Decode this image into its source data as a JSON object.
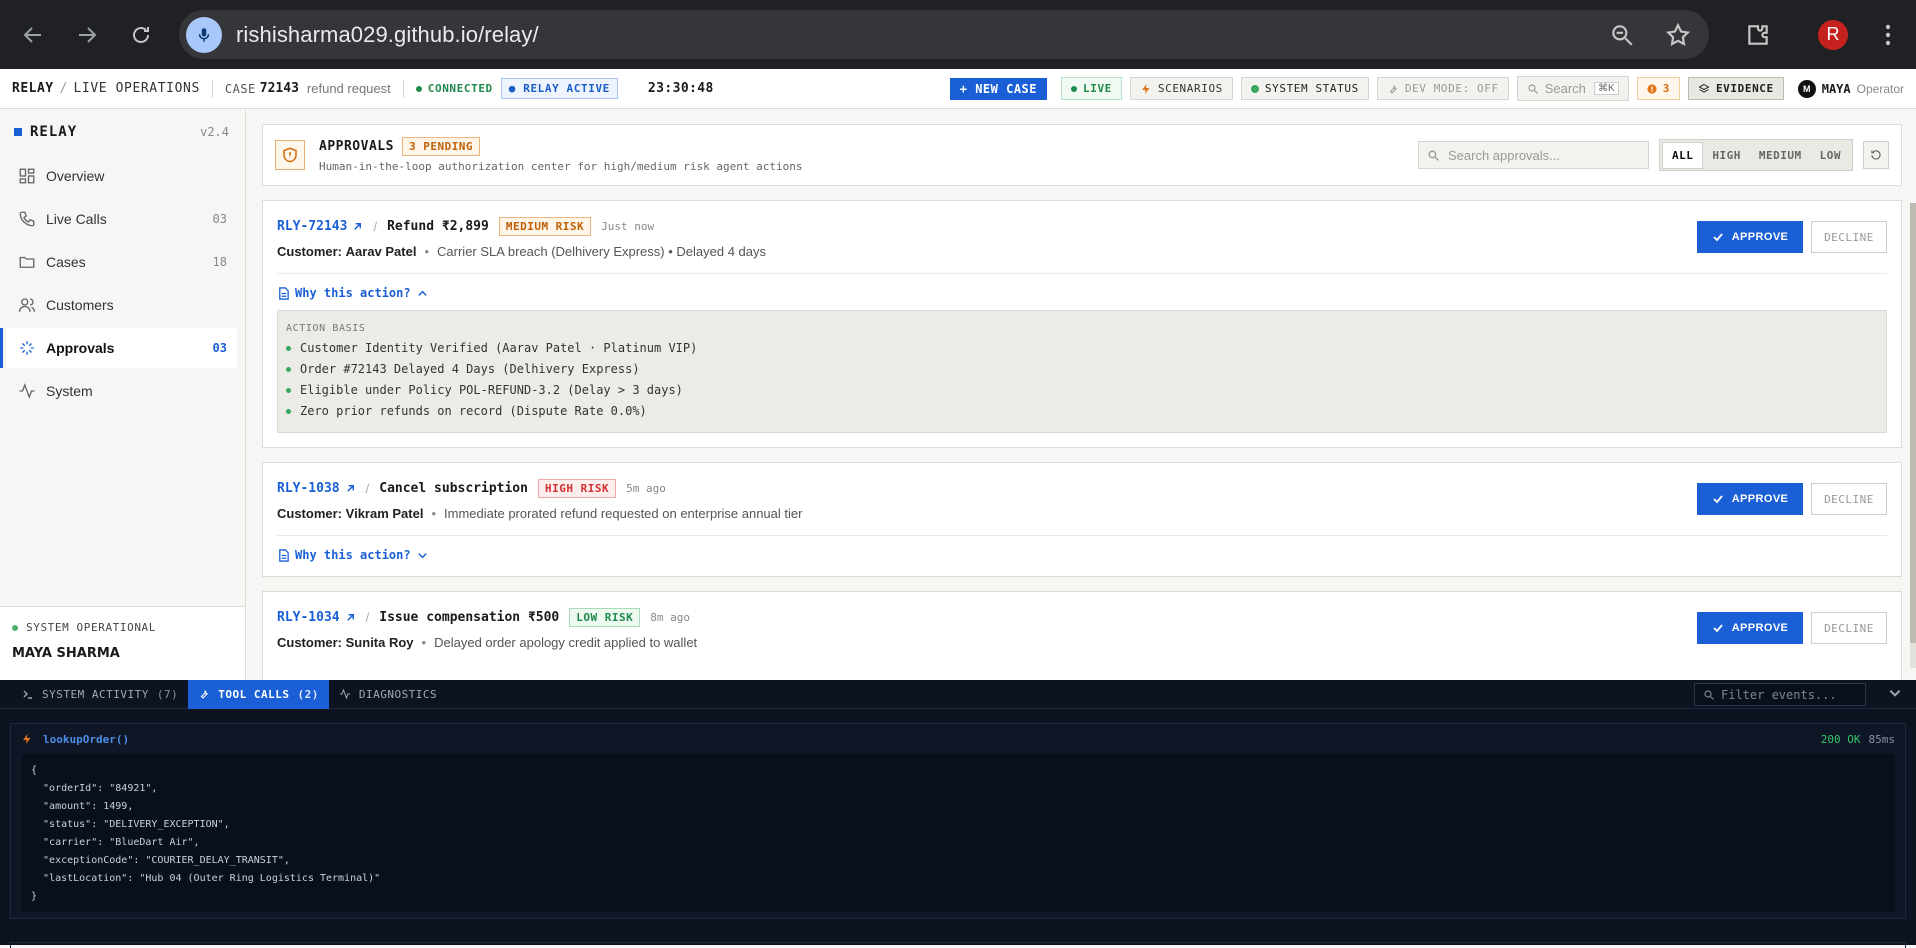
{
  "browser": {
    "url": "rishisharma029.github.io/relay/",
    "avatar_letter": "R"
  },
  "topbar": {
    "brand": "RELAY",
    "sep": "/",
    "section": "LIVE OPERATIONS",
    "case_label": "CASE",
    "case_number": "72143",
    "case_desc": "refund request",
    "connected": "CONNECTED",
    "relay_active": "● RELAY ACTIVE",
    "clock": "23:30:48",
    "new_case": "+ NEW CASE",
    "live": "LIVE",
    "scenarios": "SCENARIOS",
    "system_status": "SYSTEM STATUS",
    "dev_mode": "DEV MODE: OFF",
    "search_placeholder": "Search",
    "search_kbd": "⌘K",
    "alerts": "3",
    "evidence": "EVIDENCE",
    "operator_initial": "M",
    "operator_name": "MAYA",
    "operator_role": "Operator"
  },
  "sidebar": {
    "title": "RELAY",
    "version": "v2.4",
    "items": [
      {
        "label": "Overview",
        "count": ""
      },
      {
        "label": "Live Calls",
        "count": "03"
      },
      {
        "label": "Cases",
        "count": "18"
      },
      {
        "label": "Customers",
        "count": ""
      },
      {
        "label": "Approvals",
        "count": "03"
      },
      {
        "label": "System",
        "count": ""
      }
    ],
    "status": "SYSTEM OPERATIONAL",
    "user": "MAYA SHARMA"
  },
  "approvals": {
    "title": "APPROVALS",
    "pending": "3 PENDING",
    "subtitle": "Human-in-the-loop authorization center for high/medium risk agent actions",
    "search_placeholder": "Search approvals...",
    "filters": [
      "ALL",
      "HIGH",
      "MEDIUM",
      "LOW"
    ],
    "approve_label": "APPROVE",
    "decline_label": "DECLINE",
    "why_label": "Why this action?",
    "customer_prefix": "Customer:",
    "cards": [
      {
        "id": "RLY-72143",
        "action": "Refund ₹2,899",
        "risk": "MEDIUM RISK",
        "time": "Just now",
        "customer": "Aarav Patel",
        "detail": "Carrier SLA breach (Delhivery Express) • Delayed 4 days",
        "basis_title": "ACTION BASIS",
        "basis": [
          "Customer Identity Verified (Aarav Patel · Platinum VIP)",
          "Order #72143 Delayed 4 Days (Delhivery Express)",
          "Eligible under Policy POL-REFUND-3.2 (Delay > 3 days)",
          "Zero prior refunds on record (Dispute Rate 0.0%)"
        ]
      },
      {
        "id": "RLY-1038",
        "action": "Cancel subscription",
        "risk": "HIGH RISK",
        "time": "5m ago",
        "customer": "Vikram Patel",
        "detail": "Immediate prorated refund requested on enterprise annual tier"
      },
      {
        "id": "RLY-1034",
        "action": "Issue compensation ₹500",
        "risk": "LOW RISK",
        "time": "8m ago",
        "customer": "Sunita Roy",
        "detail": "Delayed order apology credit applied to wallet"
      }
    ]
  },
  "bottom": {
    "tabs": [
      {
        "label": "SYSTEM ACTIVITY",
        "count": "(7)"
      },
      {
        "label": "TOOL CALLS",
        "count": "(2)"
      },
      {
        "label": "DIAGNOSTICS",
        "count": ""
      }
    ],
    "filter_placeholder": "Filter events...",
    "call": {
      "name": "lookupOrder()",
      "status": "200 OK",
      "duration": "85ms",
      "lines": [
        "{",
        "  \"orderId\": \"84921\",",
        "  \"amount\": 1499,",
        "  \"status\": \"DELIVERY_EXCEPTION\",",
        "  \"carrier\": \"BlueDart Air\",",
        "  \"exceptionCode\": \"COURIER_DELAY_TRANSIT\",",
        "  \"lastLocation\": \"Hub 04 (Outer Ring Logistics Terminal)\"",
        "}"
      ]
    }
  }
}
